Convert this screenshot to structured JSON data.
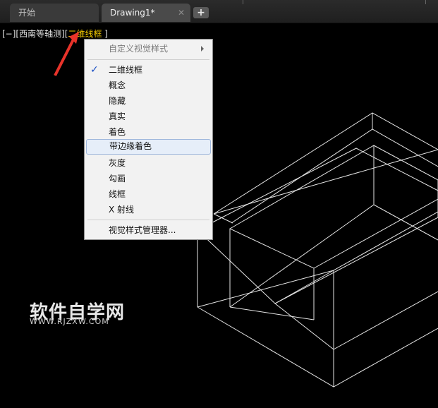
{
  "tabs": [
    {
      "label": "开始"
    },
    {
      "label": "Drawing1*"
    }
  ],
  "tab_close_glyph": "✕",
  "tab_add_glyph": "+",
  "viewport": {
    "prefix": "[−][西南等轴测][",
    "visual_style": "二维线框",
    "suffix": " ]"
  },
  "menu": {
    "items": [
      {
        "label": "自定义视觉样式",
        "disabled": true,
        "submenu": true
      },
      {
        "label": "二维线框",
        "checked": true
      },
      {
        "label": "概念"
      },
      {
        "label": "隐藏"
      },
      {
        "label": "真实"
      },
      {
        "label": "着色"
      },
      {
        "label": "带边缘着色",
        "highlighted": true
      },
      {
        "label": "灰度"
      },
      {
        "label": "勾画"
      },
      {
        "label": "线框"
      },
      {
        "label": "X 射线"
      },
      {
        "label": "视觉样式管理器..."
      }
    ],
    "check_glyph": "✓"
  },
  "watermark": {
    "title": "软件自学网",
    "url": "WWW.RJZXW.COM"
  },
  "colors": {
    "background": "#000000",
    "accent_yellow": "#f0c800",
    "annotation_red": "#e8332a",
    "wireframe": "#e6e6e6"
  }
}
